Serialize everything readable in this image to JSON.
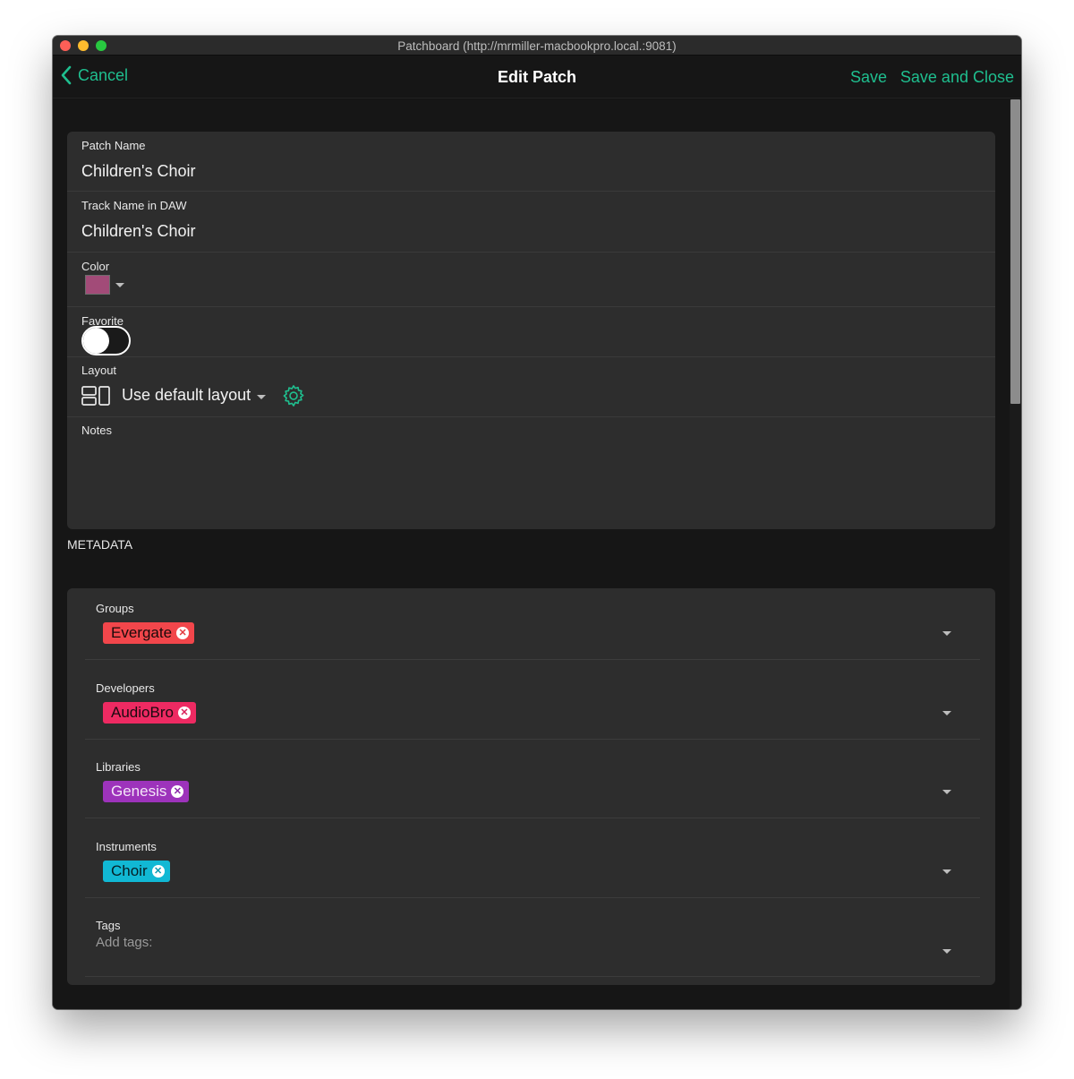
{
  "window": {
    "title": "Patchboard (http://mrmiller-macbookpro.local.:9081)"
  },
  "navbar": {
    "cancel_label": "Cancel",
    "title": "Edit Patch",
    "save_label": "Save",
    "save_close_label": "Save and Close"
  },
  "form": {
    "patch_name": {
      "label": "Patch Name",
      "value": "Children's Choir"
    },
    "track_name": {
      "label": "Track Name in DAW",
      "value": "Children's Choir"
    },
    "color": {
      "label": "Color",
      "value": "#a24b78"
    },
    "favorite": {
      "label": "Favorite",
      "on": false
    },
    "layout": {
      "label": "Layout",
      "value": "Use default layout"
    },
    "notes": {
      "label": "Notes",
      "value": ""
    }
  },
  "metadata": {
    "heading": "METADATA",
    "groups": {
      "label": "Groups",
      "chips": [
        {
          "text": "Evergate",
          "bg": "#f2464b",
          "fg": "#1a0a0a",
          "x_color": "#e33a3f"
        }
      ]
    },
    "developers": {
      "label": "Developers",
      "chips": [
        {
          "text": "AudioBro",
          "bg": "#ee2a62",
          "fg": "#1a0a10",
          "x_color": "#d8205a"
        }
      ]
    },
    "libraries": {
      "label": "Libraries",
      "chips": [
        {
          "text": "Genesis",
          "bg": "#9d33bb",
          "fg": "#f3e6f7",
          "x_color": "#8a2aa8"
        }
      ]
    },
    "instruments": {
      "label": "Instruments",
      "chips": [
        {
          "text": "Choir",
          "bg": "#11b8d4",
          "fg": "#061e24",
          "x_color": "#0c9ab2"
        }
      ]
    },
    "tags": {
      "label": "Tags",
      "placeholder": "Add tags:"
    }
  },
  "colors": {
    "accent": "#1fbf8f",
    "background": "#161616",
    "card": "#2d2d2d"
  },
  "icons": {
    "back": "chevron-left-icon",
    "layout": "layout-icon",
    "settings": "gear-icon",
    "dropdown": "caret-down-icon",
    "remove": "close-circle-icon"
  }
}
